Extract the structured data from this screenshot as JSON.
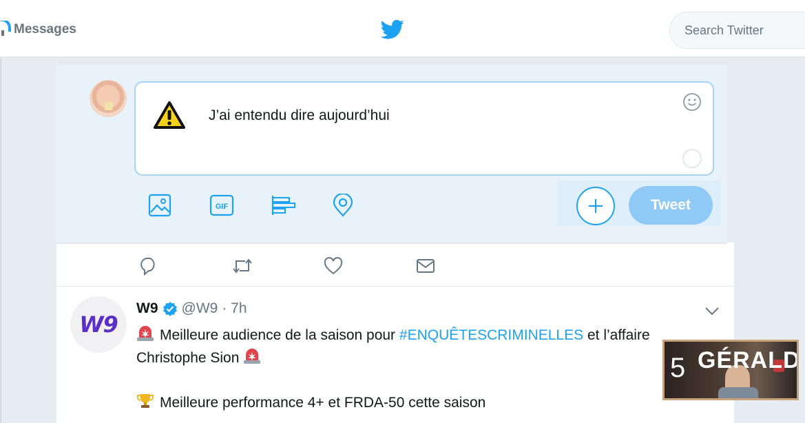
{
  "topbar": {
    "messages_label": "Messages",
    "search_placeholder": "Search Twitter"
  },
  "compose": {
    "text": "J’ai entendu dire aujourd’hui",
    "tools": [
      "image-icon",
      "gif-icon",
      "poll-icon",
      "location-icon"
    ],
    "gif_label": "GIF",
    "tweet_button": "Tweet"
  },
  "feed": {
    "actions": [
      "reply-icon",
      "retweet-icon",
      "like-icon",
      "dm-icon"
    ],
    "tweet": {
      "avatar_text": "W9",
      "name": "W9",
      "handle": "@W9",
      "time": "· 7h",
      "line1_prefix": "Meilleure audience de la saison pour ",
      "hashtag": "#ENQUÊTESCRIMINELLES",
      "line1_suffix": " et l’affaire",
      "line2": "Christophe Sion",
      "line3": "Meilleure performance 4+ et FRDA-50 cette saison"
    }
  },
  "overlay": {
    "number": "5",
    "title": "GÉRALD"
  },
  "colors": {
    "twitter_blue": "#1da1f2",
    "tweet_button_disabled": "#8fc9f5",
    "compose_bg": "#e8f2fb"
  }
}
